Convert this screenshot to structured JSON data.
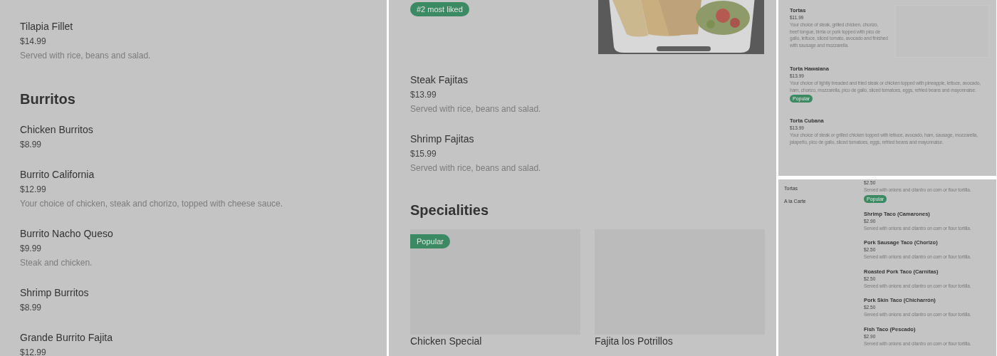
{
  "left_panel": {
    "items": [
      {
        "name": "Tilapia Fillet",
        "price": "$14.99",
        "description": "Served with rice, beans and salad."
      }
    ],
    "sections": [
      {
        "heading": "Burritos",
        "items": [
          {
            "name": "Chicken Burritos",
            "price": "$8.99"
          },
          {
            "name": "Burrito California",
            "price": "$12.99",
            "description": "Your choice of chicken, steak and chorizo, topped with cheese sauce."
          },
          {
            "name": "Burrito Nacho Queso",
            "price": "$9.99",
            "description": "Steak and chicken."
          },
          {
            "name": "Shrimp Burritos",
            "price": "$8.99"
          },
          {
            "name": "Grande Burrito Fajita",
            "price": "$12.99"
          }
        ]
      }
    ]
  },
  "middle_panel": {
    "badge": "#2 most liked",
    "items": [
      {
        "name": "Steak Fajitas",
        "price": "$13.99",
        "description": "Served with rice, beans and salad."
      },
      {
        "name": "Shrimp Fajitas",
        "price": "$15.99",
        "description": "Served with rice, beans and salad."
      }
    ],
    "section": {
      "heading": "Specialities",
      "cards": [
        {
          "title": "Chicken Special",
          "badge": "Popular"
        },
        {
          "title": "Fajita los Potrillos"
        }
      ]
    }
  },
  "right_top_panel": {
    "items": [
      {
        "name": "Tortas",
        "price": "$11.99",
        "description": "Your choice of steak, grilled chicken, chorizo, beef tongue, birria or pork topped with pico de gallo, lettuce, sliced tomato, avocado and finished with sausage and mozzarella.",
        "has_image": true
      },
      {
        "name": "Torta Hawaiana",
        "price": "$13.99",
        "description": "Your choice of lightly breaded and fried steak or chicken topped with pineapple, lettuce, avocado, ham, chorizo, mozzarella, pico de gallo, sliced tomatoes, eggs, refried beans and mayonnaise.",
        "badge": "Popular"
      },
      {
        "name": "Torta Cubana",
        "price": "$13.99",
        "description": "Your choice of steak or grilled chicken topped with lettuce, avocado, ham, sausage, mozzarella, jalapeño, pico de gallo, sliced tomatoes, eggs, refried beans and mayonnaise."
      }
    ]
  },
  "right_bottom_panel": {
    "sidebar": [
      {
        "label": "Tortas"
      },
      {
        "label": "A la Carte"
      }
    ],
    "items": [
      {
        "price": "$2.50",
        "description": "Served with onions and cilantro on corn or flour tortilla.",
        "badge": "Popular"
      },
      {
        "name": "Shrimp Taco (Camarones)",
        "price": "$2.90",
        "description": "Served with onions and cilantro on corn or flour tortilla."
      },
      {
        "name": "Pork Sausage Taco (Chorizo)",
        "price": "$2.50",
        "description": "Served with onions and cilantro on corn or flour tortilla."
      },
      {
        "name": "Roasted Pork Taco (Carnitas)",
        "price": "$2.50",
        "description": "Served with onions and cilantro on corn or flour tortilla."
      },
      {
        "name": "Pork Skin Taco (Chicharrón)",
        "price": "$2.50",
        "description": "Served with onions and cilantro on corn or flour tortilla."
      },
      {
        "name": "Fish Taco (Pescado)",
        "price": "$2.90",
        "description": "Served with onions and cilantro on corn or flour tortilla."
      }
    ]
  }
}
